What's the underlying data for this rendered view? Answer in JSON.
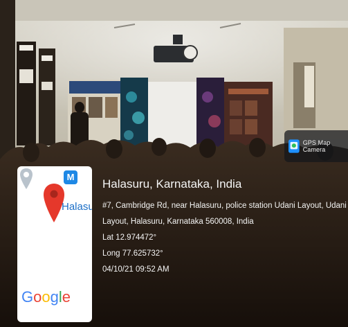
{
  "gps_badge": {
    "label": "GPS Map Camera",
    "icon": "gps-camera-icon"
  },
  "map_card": {
    "place_label": "Halasu",
    "logo_text": "Google",
    "pin_color": "#e5382b",
    "badge_letter": "M"
  },
  "location": {
    "title": "Halasuru, Karnataka, India",
    "address_line1": "#7, Cambridge Rd, near Halasuru, police station Udani Layout, Udani",
    "address_line2": "Layout, Halasuru, Karnataka 560008, India",
    "lat": "Lat 12.974472°",
    "long": "Long 77.625732°",
    "datetime": "04/10/21 09:52 AM"
  }
}
